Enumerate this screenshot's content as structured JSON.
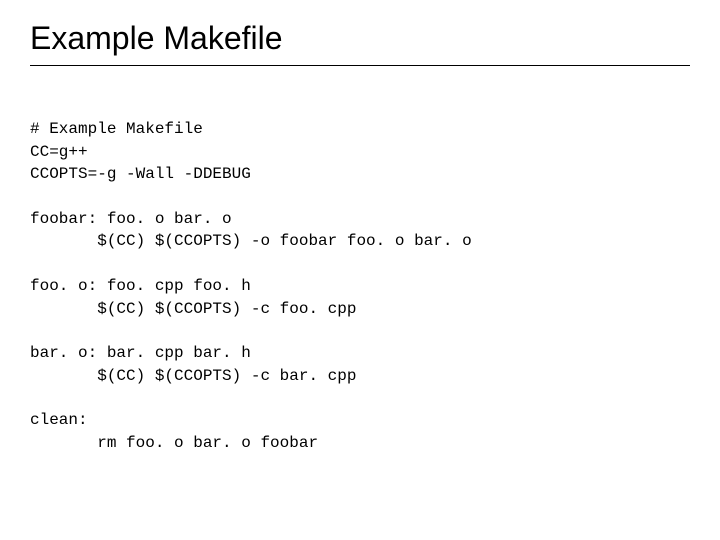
{
  "title": "Example Makefile",
  "code": {
    "line1": "# Example Makefile",
    "line2": "CC=g++",
    "line3": "CCOPTS=-g -Wall -DDEBUG",
    "line4": "foobar: foo. o bar. o",
    "line5": "       $(CC) $(CCOPTS) -o foobar foo. o bar. o",
    "line6": "foo. o: foo. cpp foo. h",
    "line7": "       $(CC) $(CCOPTS) -c foo. cpp",
    "line8": "bar. o: bar. cpp bar. h",
    "line9": "       $(CC) $(CCOPTS) -c bar. cpp",
    "line10": "clean:",
    "line11": "       rm foo. o bar. o foobar"
  }
}
